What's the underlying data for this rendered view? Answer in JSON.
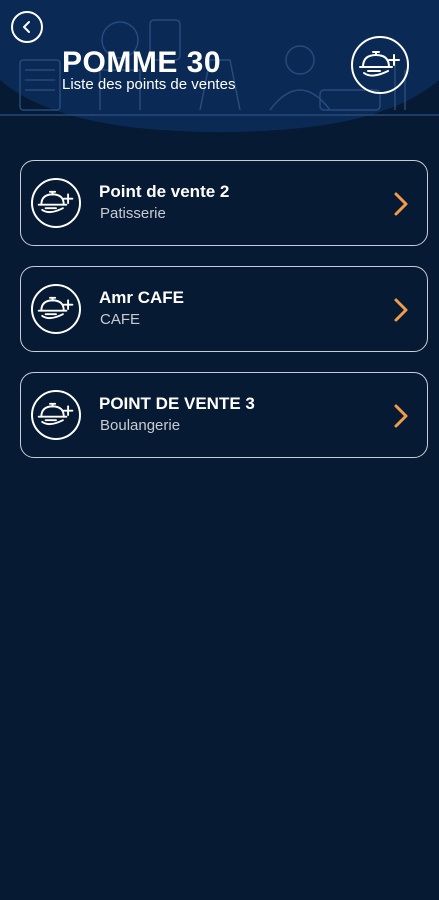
{
  "header": {
    "title": "POMME 30",
    "subtitle": "Liste des points de ventes",
    "back_icon": "chevron-left-icon",
    "add_icon": "cloche-plus-icon"
  },
  "colors": {
    "background": "#061a33",
    "header_background": "#0a2a55",
    "accent_chevron": "#f29b4b",
    "card_border": "#c9ccd2",
    "text": "#ffffff",
    "subtext": "#c9ccd2"
  },
  "points_of_sale": [
    {
      "name": "Point de vente 2",
      "type": "Patisserie",
      "icon": "cloche-plus-icon"
    },
    {
      "name": "Amr CAFE",
      "type": "CAFE",
      "icon": "cloche-plus-icon"
    },
    {
      "name": "POINT DE VENTE 3",
      "type": "Boulangerie",
      "icon": "cloche-plus-icon"
    }
  ]
}
